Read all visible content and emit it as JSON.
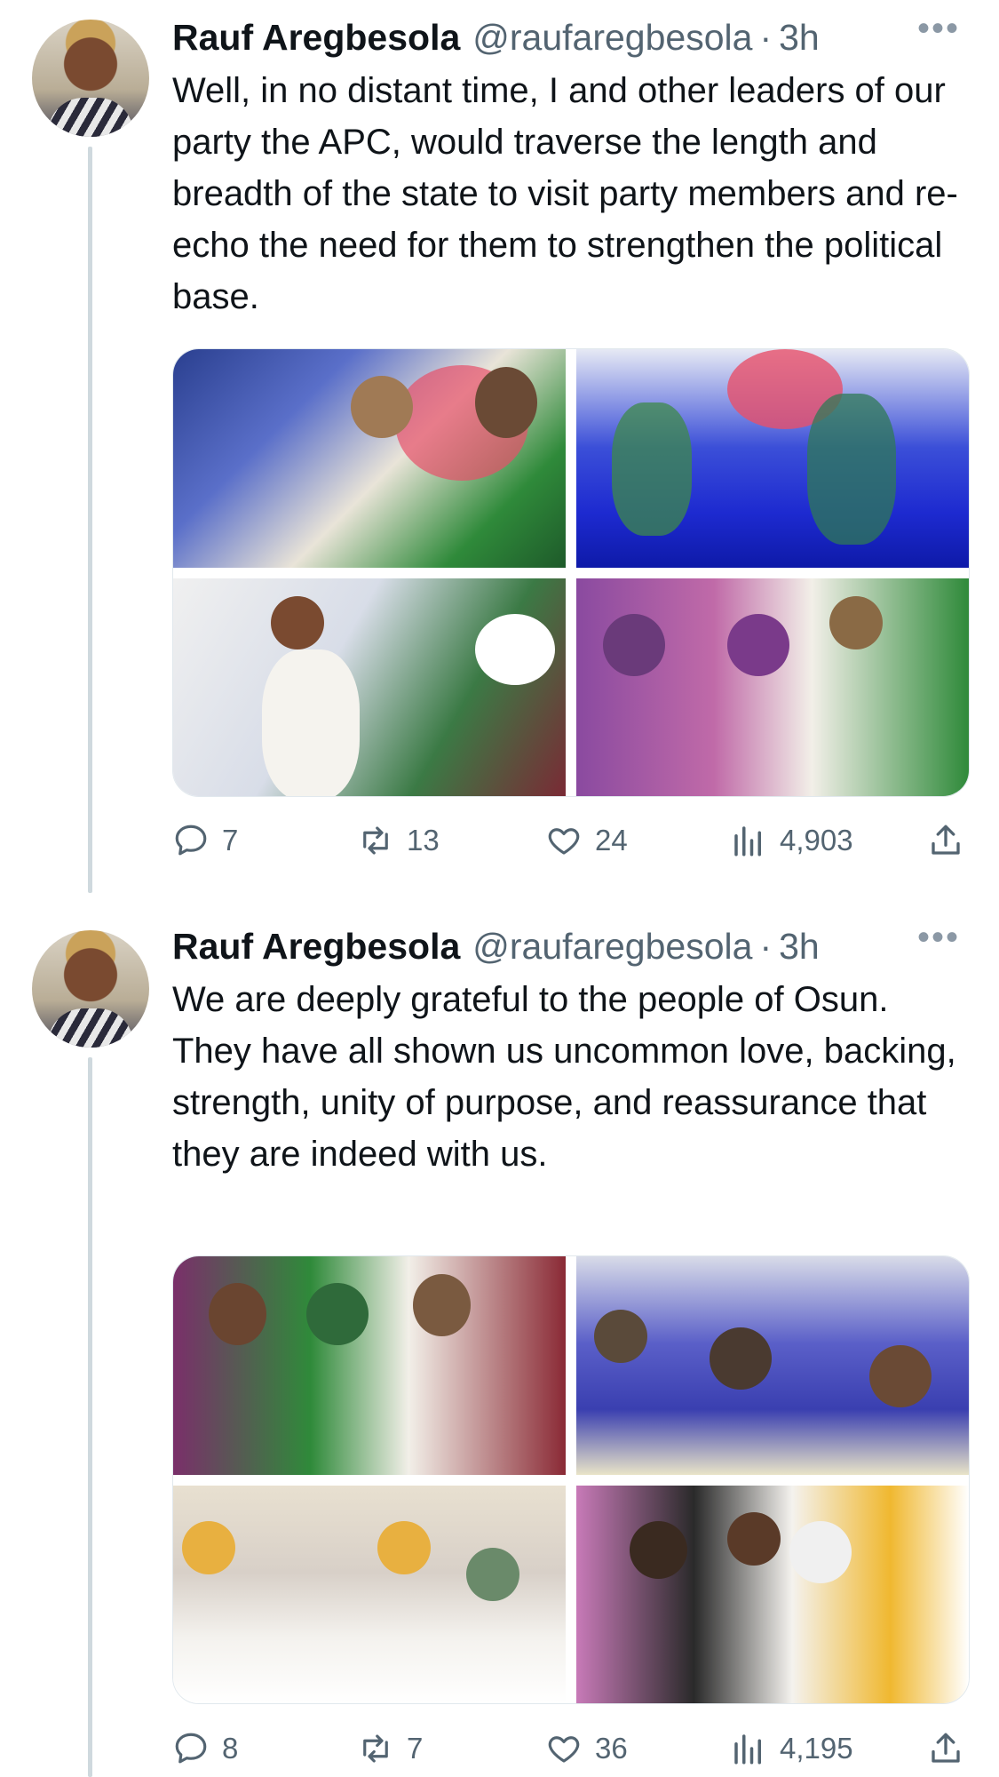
{
  "tweets": [
    {
      "author_name": "Rauf Aregbesola",
      "handle": "@raufaregbesola",
      "separator": "·",
      "time": "3h",
      "more": "•••",
      "text": "Well, in no distant time, I and other leaders of our party the APC, would traverse the length and breadth of the state to visit party members and re-echo the need for them to strengthen the political base.",
      "replies": "7",
      "retweets": "13",
      "likes": "24",
      "views": "4,903"
    },
    {
      "author_name": "Rauf Aregbesola",
      "handle": "@raufaregbesola",
      "separator": "·",
      "time": "3h",
      "more": "•••",
      "text": "We are deeply grateful to the people of Osun. They have all shown us uncommon love, backing, strength, unity of purpose, and reassurance that they are indeed with us.",
      "replies": "8",
      "retweets": "7",
      "likes": "36",
      "views": "4,195"
    }
  ],
  "colors": {
    "text": "#0f1419",
    "secondary": "#536471",
    "thread_line": "#cfd9de"
  },
  "icons": [
    "reply-icon",
    "retweet-icon",
    "like-icon",
    "views-icon",
    "share-icon",
    "more-icon"
  ]
}
